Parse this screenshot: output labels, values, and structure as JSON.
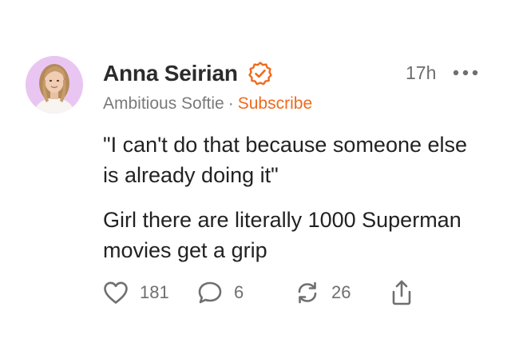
{
  "post": {
    "author": {
      "name": "Anna Seirian",
      "verified": true,
      "publication": "Ambitious Softie",
      "separator": "·",
      "subscribe_label": "Subscribe"
    },
    "time": "17h",
    "paragraphs": [
      "\"I can't do that because someone else is already doing it\"",
      "Girl there are literally 1000 Superman movies get a grip"
    ],
    "actions": {
      "likes": "181",
      "comments": "6",
      "restacks": "26"
    }
  },
  "icons": {
    "verified": "verified-badge-icon",
    "more": "more-options-icon",
    "like": "heart-icon",
    "comment": "speech-bubble-icon",
    "restack": "restack-arrows-icon",
    "share": "share-icon"
  },
  "colors": {
    "accent": "#f06a1c",
    "avatar_background": "#e9c6f2",
    "text": "#222222",
    "muted": "#7a7a7a"
  }
}
